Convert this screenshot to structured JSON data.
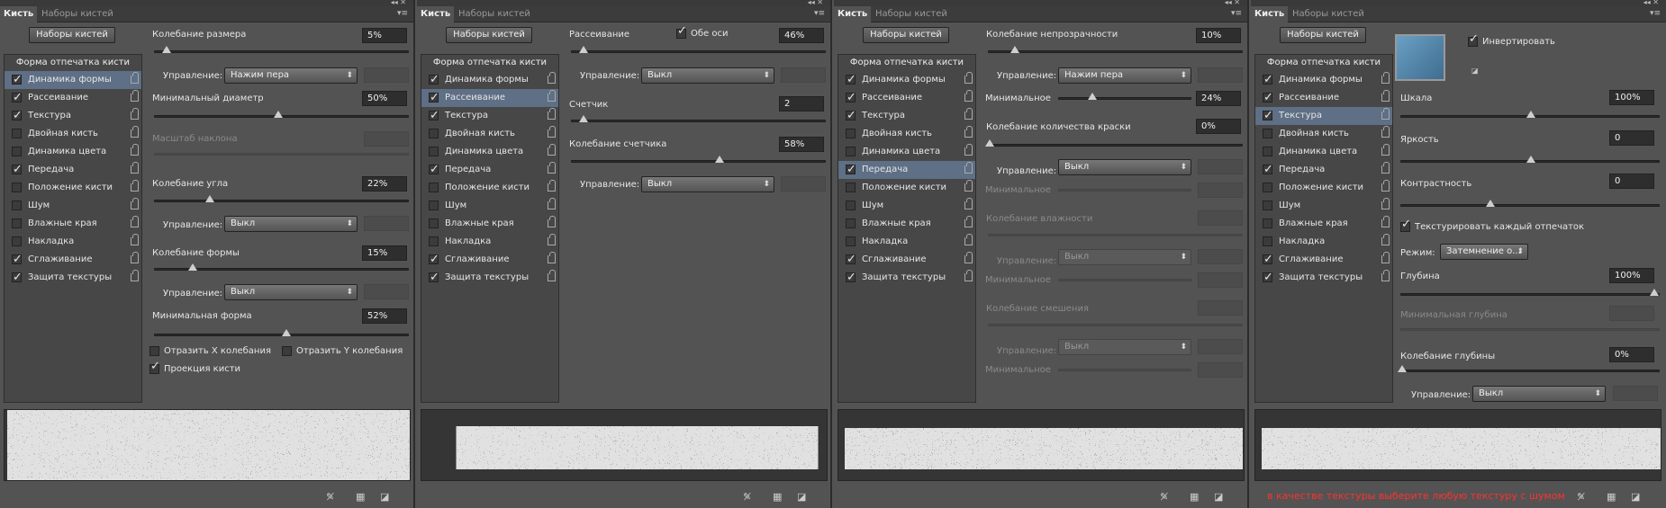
{
  "tabs": {
    "brush": "Кисть",
    "presets": "Наборы кистей"
  },
  "presets_button": "Наборы кистей",
  "sidebar": {
    "header": "Форма отпечатка кисти",
    "items": [
      {
        "label": "Динамика формы",
        "checked": true
      },
      {
        "label": "Рассеивание",
        "checked": true
      },
      {
        "label": "Текстура",
        "checked": true
      },
      {
        "label": "Двойная кисть",
        "checked": false
      },
      {
        "label": "Динамика цвета",
        "checked": false
      },
      {
        "label": "Передача",
        "checked": true
      },
      {
        "label": "Положение кисти",
        "checked": false
      },
      {
        "label": "Шум",
        "checked": false
      },
      {
        "label": "Влажные края",
        "checked": false
      },
      {
        "label": "Накладка",
        "checked": false
      },
      {
        "label": "Сглаживание",
        "checked": true
      },
      {
        "label": "Защита текстуры",
        "checked": true
      }
    ]
  },
  "panel1": {
    "size_jitter": {
      "label": "Колебание размера",
      "value": "5%",
      "level": 0.05
    },
    "control1": {
      "label": "Управление:",
      "value": "Нажим пера"
    },
    "min_diameter": {
      "label": "Минимальный диаметр",
      "value": "50%",
      "level": 0.5
    },
    "tilt_scale": {
      "label": "Масштаб наклона"
    },
    "angle_jitter": {
      "label": "Колебание угла",
      "value": "22%",
      "level": 0.22
    },
    "control2": {
      "label": "Управление:",
      "value": "Выкл"
    },
    "roundness_jitter": {
      "label": "Колебание формы",
      "value": "15%",
      "level": 0.15
    },
    "control3": {
      "label": "Управление:",
      "value": "Выкл"
    },
    "min_roundness": {
      "label": "Минимальная форма",
      "value": "52%",
      "level": 0.52
    },
    "flip_x": "Отразить X колебания",
    "flip_y": "Отразить Y колебания",
    "projection": "Проекция кисти"
  },
  "panel2": {
    "scatter": {
      "label": "Рассеивание",
      "value": "46%",
      "level": 0.46
    },
    "both_axes": "Обе оси",
    "control1": {
      "label": "Управление:",
      "value": "Выкл"
    },
    "count": {
      "label": "Счетчик",
      "value": "2",
      "level": 0.05
    },
    "count_jitter": {
      "label": "Колебание счетчика",
      "value": "58%",
      "level": 0.58
    },
    "control2": {
      "label": "Управление:",
      "value": "Выкл"
    }
  },
  "panel3": {
    "opacity_jitter": {
      "label": "Колебание непрозрачности",
      "value": "10%",
      "level": 0.1
    },
    "control1": {
      "label": "Управление:",
      "value": "Нажим пера"
    },
    "minimum1": {
      "label": "Минимальное",
      "value": "24%",
      "level": 0.24
    },
    "flow_jitter": {
      "label": "Колебание количества краски",
      "value": "0%",
      "level": 0
    },
    "control2": {
      "label": "Управление:",
      "value": "Выкл"
    },
    "minimum2": {
      "label": "Минимальное"
    },
    "wetness_jitter": {
      "label": "Колебание влажности"
    },
    "control3": {
      "label": "Управление:",
      "value": "Выкл"
    },
    "minimum3": {
      "label": "Минимальное"
    },
    "mix_jitter": {
      "label": "Колебание смешения"
    },
    "control4": {
      "label": "Управление:",
      "value": "Выкл"
    },
    "minimum4": {
      "label": "Минимальное"
    }
  },
  "panel4": {
    "invert": "Инвертировать",
    "scale": {
      "label": "Шкала",
      "value": "100%",
      "level": 0.5
    },
    "brightness": {
      "label": "Яркость",
      "value": "0",
      "level": 0.5
    },
    "contrast": {
      "label": "Контрастность",
      "value": "0",
      "level": 0.5
    },
    "texture_each_tip": "Текстурировать каждый отпечаток",
    "mode": {
      "label": "Режим:",
      "value": "Затемнение  о..."
    },
    "depth": {
      "label": "Глубина",
      "value": "100%",
      "level": 1
    },
    "min_depth": {
      "label": "Минимальная глубина"
    },
    "depth_jitter": {
      "label": "Колебание глубины",
      "value": "0%",
      "level": 0
    },
    "control": {
      "label": "Управление:",
      "value": "Выкл"
    },
    "hint": "в качестве текстуры выберите любую текстуру с шумом"
  },
  "colors": {
    "selection": "#5e6f86",
    "hint": "#ff3030"
  }
}
